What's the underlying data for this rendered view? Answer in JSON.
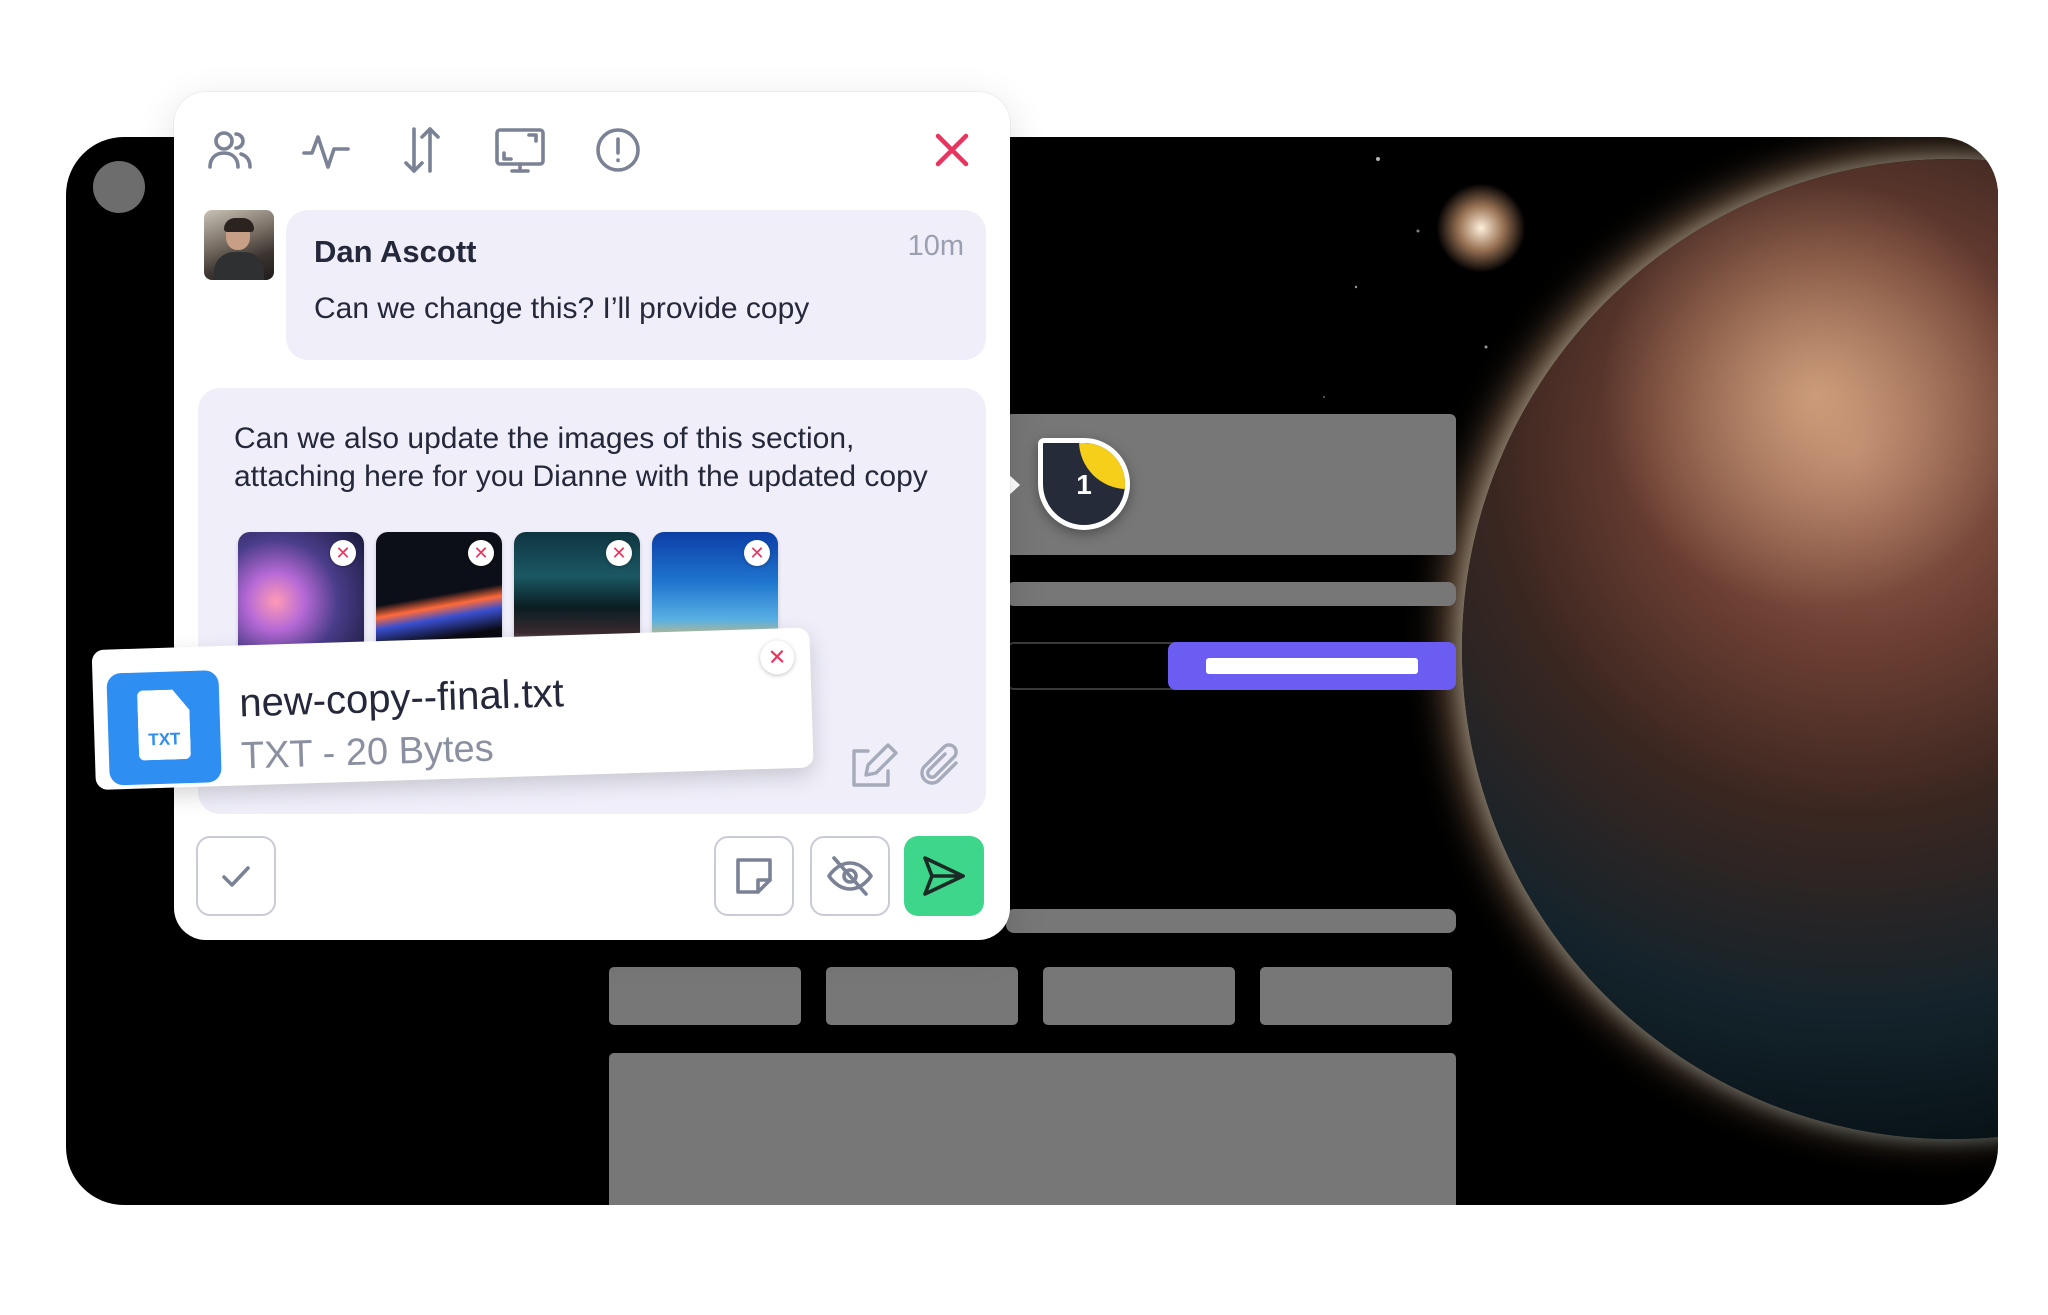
{
  "window": {
    "theme_colors": {
      "accent": "#6b5cf2",
      "send": "#3ed68a",
      "close": "#e8355f",
      "marker_pie": "#f5cf1a"
    }
  },
  "toolbar": {
    "icons": [
      "users-icon",
      "activity-icon",
      "sort-icon",
      "screen-icon",
      "alert-icon",
      "close-icon"
    ]
  },
  "comment": {
    "author": "Dan Ascott",
    "time": "10m",
    "text": "Can we change this? I’ll provide copy"
  },
  "reply": {
    "text": "Can we also update the images of this section, attaching here for you Dianne with the updated copy",
    "attachments_count": 4,
    "remove_glyph": "✕"
  },
  "file": {
    "name": "new-copy--final.txt",
    "meta": "TXT - 20 Bytes",
    "ext": "TXT"
  },
  "marker": {
    "number": "1"
  }
}
